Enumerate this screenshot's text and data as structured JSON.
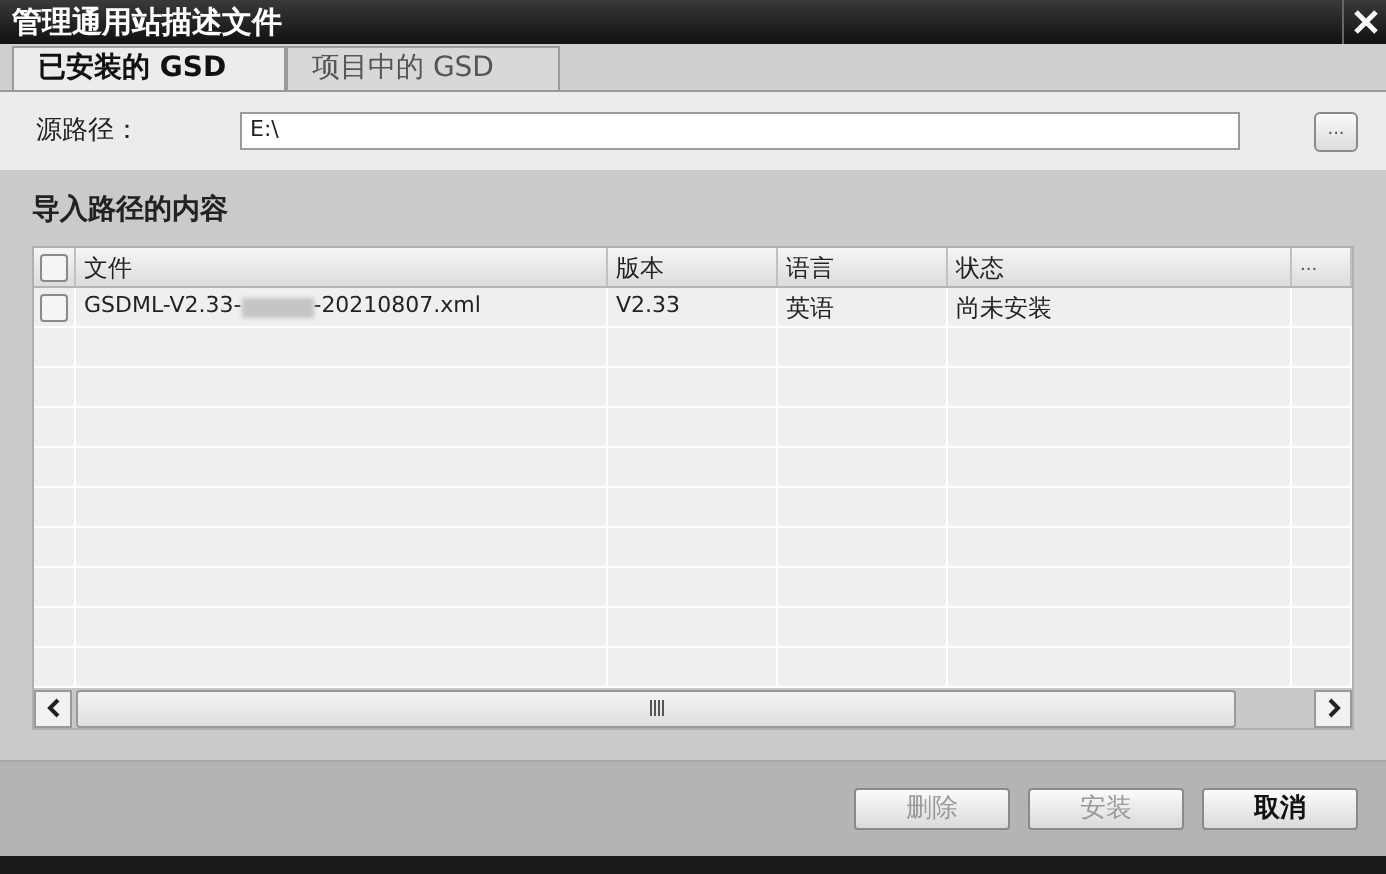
{
  "window": {
    "title": "管理通用站描述文件"
  },
  "tabs": [
    {
      "label": "已安装的 GSD",
      "selected": true
    },
    {
      "label": "项目中的 GSD",
      "selected": false
    }
  ],
  "source_path": {
    "label": "源路径：",
    "value": "E:\\",
    "browse": "..."
  },
  "section": {
    "title": "导入路径的内容"
  },
  "table": {
    "columns": [
      "文件",
      "版本",
      "语言",
      "状态",
      "..."
    ],
    "header_checked": false,
    "rows": [
      {
        "checked": false,
        "file_start": "GSDML-V2.33-",
        "file_end": "-20210807.xml",
        "version": "V2.33",
        "language": "英语",
        "status": "尚未安装"
      }
    ]
  },
  "buttons": [
    {
      "label": "删除",
      "disabled": true
    },
    {
      "label": "安装",
      "disabled": true
    },
    {
      "label": "取消",
      "disabled": false
    }
  ]
}
